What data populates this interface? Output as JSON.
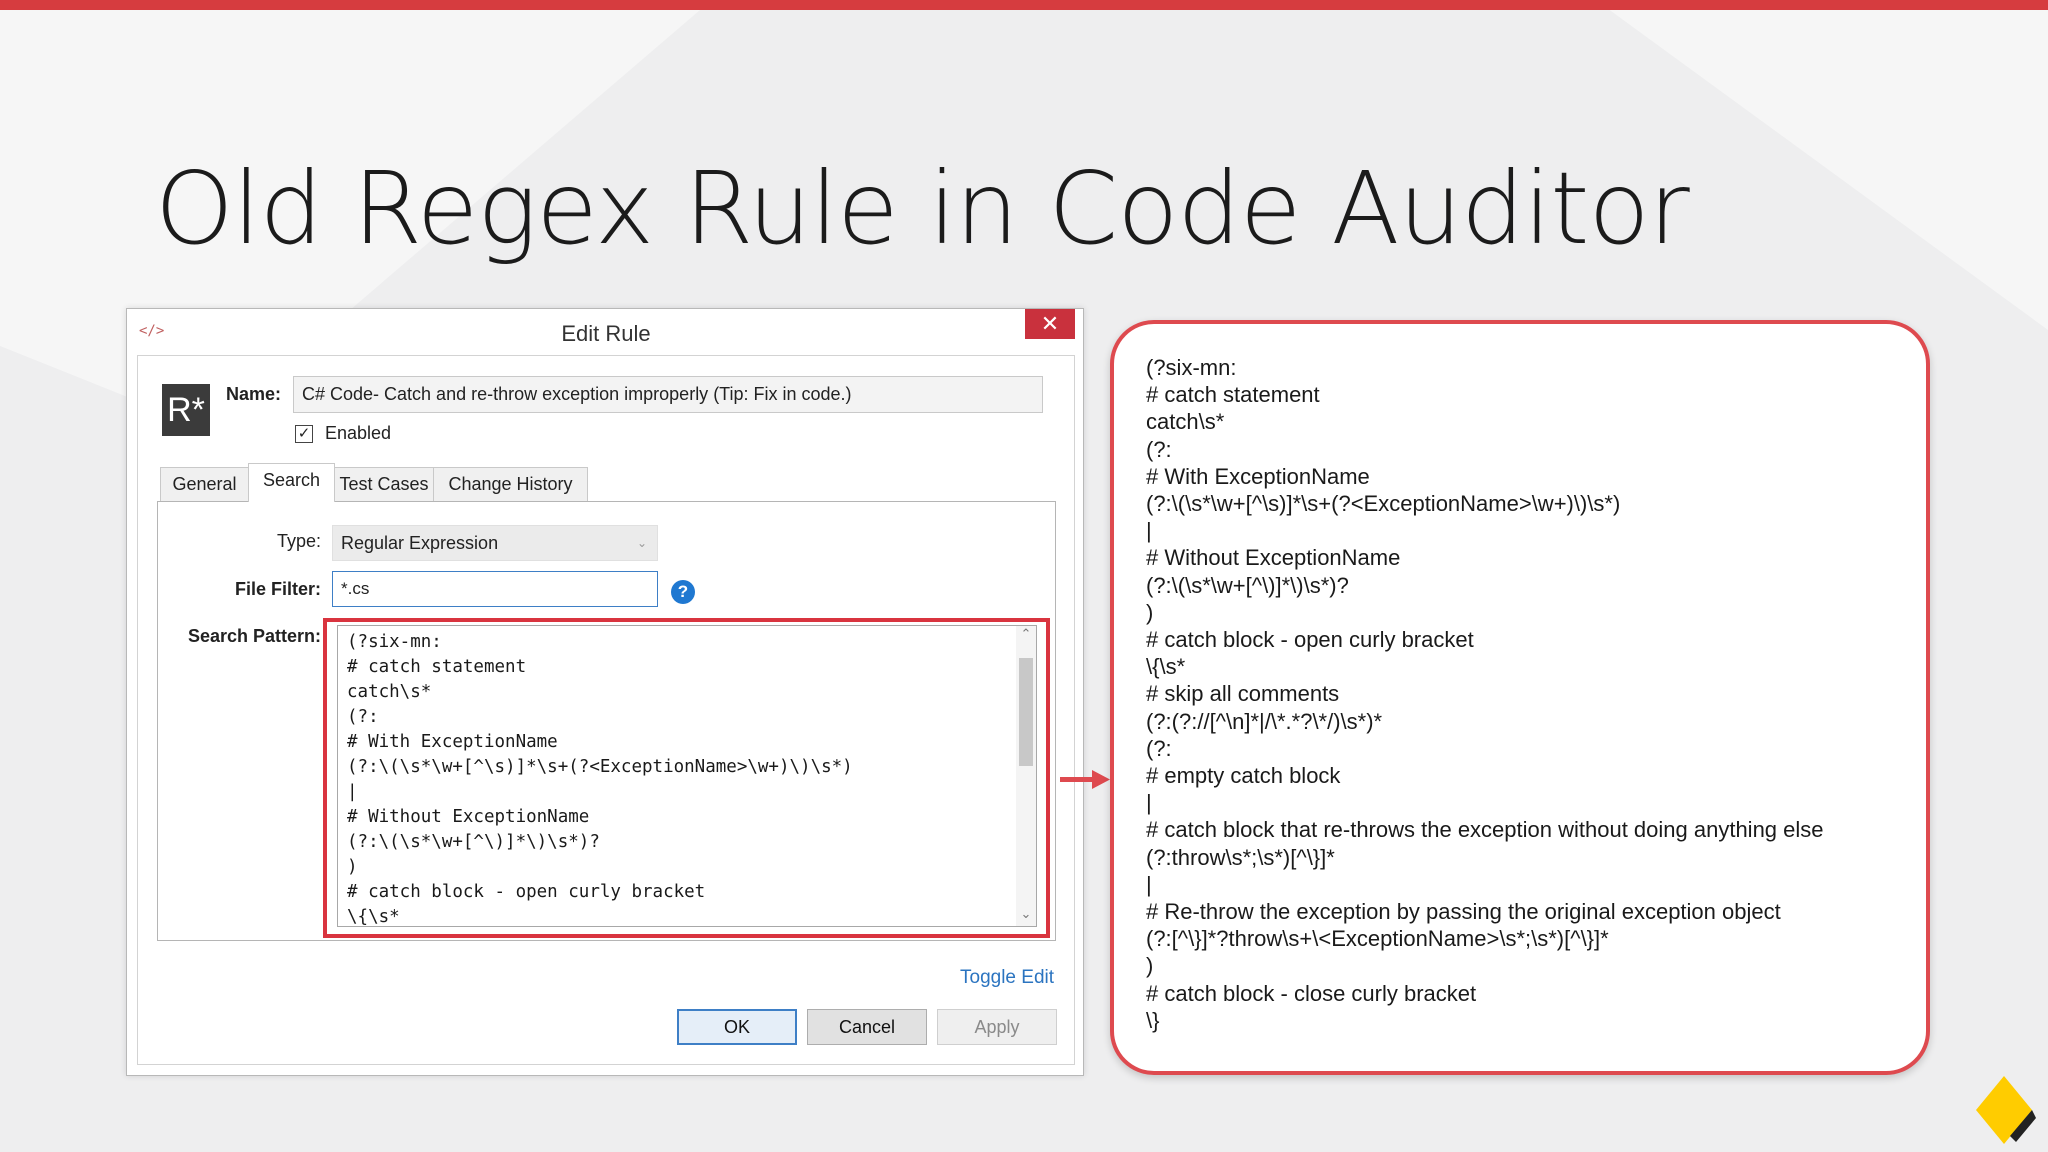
{
  "slide": {
    "title": "Old Regex Rule in Code Auditor",
    "accent_color": "#d63c3f"
  },
  "dialog": {
    "icon": "</>",
    "title": "Edit Rule",
    "close_icon": "close-icon",
    "logo_text": "R*",
    "name_label": "Name:",
    "name_value": "C# Code- Catch and re-throw exception improperly (Tip: Fix in code.)",
    "enabled_label": "Enabled",
    "enabled_checked": true,
    "tabs": [
      {
        "label": "General",
        "active": false
      },
      {
        "label": "Search",
        "active": true
      },
      {
        "label": "Test Cases",
        "active": false
      },
      {
        "label": "Change History",
        "active": false
      }
    ],
    "type_label": "Type:",
    "type_value": "Regular Expression",
    "file_filter_label": "File Filter:",
    "file_filter_value": "*.cs",
    "search_pattern_label": "Search Pattern:",
    "search_pattern_lines": [
      "(?six-mn:",
      "# catch statement",
      "catch\\s*",
      "(?:",
      "# With ExceptionName",
      "(?:\\(\\s*\\w+[^\\s)]*\\s+(?<ExceptionName>\\w+)\\)\\s*)",
      "|",
      "# Without ExceptionName",
      "(?:\\(\\s*\\w+[^\\)]*\\)\\s*)?",
      ")",
      "# catch block - open curly bracket",
      "\\{\\s*"
    ],
    "toggle_edit": "Toggle Edit",
    "buttons": {
      "ok": "OK",
      "cancel": "Cancel",
      "apply": "Apply"
    }
  },
  "callout": {
    "lines": [
      "(?six-mn:",
      "# catch statement",
      "catch\\s*",
      "(?:",
      "# With ExceptionName",
      "(?:\\(\\s*\\w+[^\\s)]*\\s+(?<ExceptionName>\\w+)\\)\\s*)",
      "|",
      "# Without ExceptionName",
      "(?:\\(\\s*\\w+[^\\)]*\\)\\s*)?",
      ")",
      "# catch block - open curly bracket",
      "\\{\\s*",
      "# skip all comments",
      "(?:(?://[^\\n]*|/\\*.*?\\*/)\\s*)*",
      "(?:",
      "# empty catch block",
      "|",
      "# catch block that re-throws the exception without doing anything else",
      "(?:throw\\s*;\\s*)[^\\}]*",
      "|",
      "# Re-throw the exception by passing the original exception object",
      "(?:[^\\}]*?throw\\s+\\<ExceptionName>\\s*;\\s*)[^\\}]*",
      ")",
      "# catch block - close curly bracket",
      "\\}"
    ]
  }
}
